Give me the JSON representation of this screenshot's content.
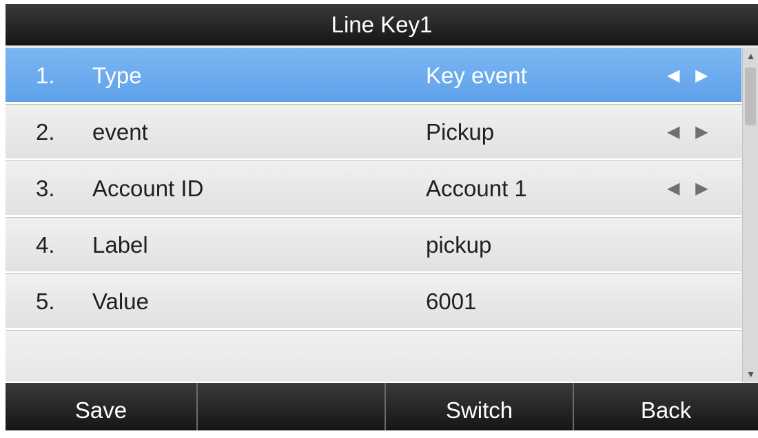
{
  "title": "Line Key1",
  "rows": [
    {
      "index": "1.",
      "label": "Type",
      "value": "Key event",
      "arrows": "◀ ▶"
    },
    {
      "index": "2.",
      "label": "event",
      "value": "Pickup",
      "arrows": "◀ ▶"
    },
    {
      "index": "3.",
      "label": "Account ID",
      "value": "Account 1",
      "arrows": "◀ ▶"
    },
    {
      "index": "4.",
      "label": "Label",
      "value": "pickup"
    },
    {
      "index": "5.",
      "label": "Value",
      "value": "6001"
    }
  ],
  "scrollbar": {
    "up_icon": "▲",
    "down_icon": "▼",
    "up_icon_name": "scroll-up-icon",
    "down_icon_name": "scroll-down-icon"
  },
  "softkeys": {
    "save": "Save",
    "blank": "",
    "switch": "Switch",
    "back": "Back"
  },
  "colors": {
    "selected": "#6aaeef",
    "bar": "#151515"
  }
}
